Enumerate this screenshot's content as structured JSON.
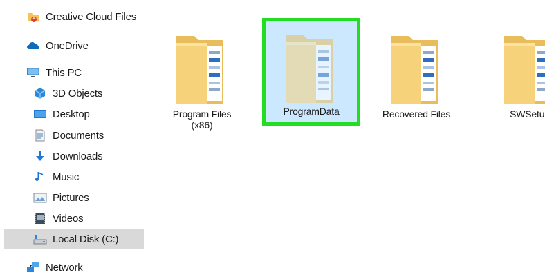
{
  "sidebar": {
    "items": [
      {
        "label": "Creative Cloud Files",
        "icon": "creative-cloud-files-icon"
      },
      {
        "label": "OneDrive",
        "icon": "onedrive-cloud-icon"
      },
      {
        "label": "This PC",
        "icon": "this-pc-monitor-icon"
      },
      {
        "label": "3D Objects",
        "icon": "3d-objects-icon"
      },
      {
        "label": "Desktop",
        "icon": "desktop-icon"
      },
      {
        "label": "Documents",
        "icon": "documents-icon"
      },
      {
        "label": "Downloads",
        "icon": "downloads-arrow-icon"
      },
      {
        "label": "Music",
        "icon": "music-note-icon"
      },
      {
        "label": "Pictures",
        "icon": "pictures-icon"
      },
      {
        "label": "Videos",
        "icon": "videos-icon"
      },
      {
        "label": "Local Disk (C:)",
        "icon": "local-disk-icon",
        "selected": true
      },
      {
        "label": "Network",
        "icon": "network-icon"
      }
    ]
  },
  "content": {
    "folders": [
      {
        "label_line1": "Program Files",
        "label_line2": "(x86)"
      },
      {
        "label_line1": "ProgramData",
        "label_line2": "",
        "selected": true
      },
      {
        "label_line1": "Recovered Files",
        "label_line2": ""
      },
      {
        "label_line1": "SWSetup",
        "label_line2": ""
      }
    ]
  },
  "colors": {
    "folder_back": "#f0c76a",
    "folder_front": "#f7d57e",
    "selection_fill": "#cce8ff",
    "highlight_border": "#22dd22",
    "sidebar_selected": "#d9d9d9"
  }
}
